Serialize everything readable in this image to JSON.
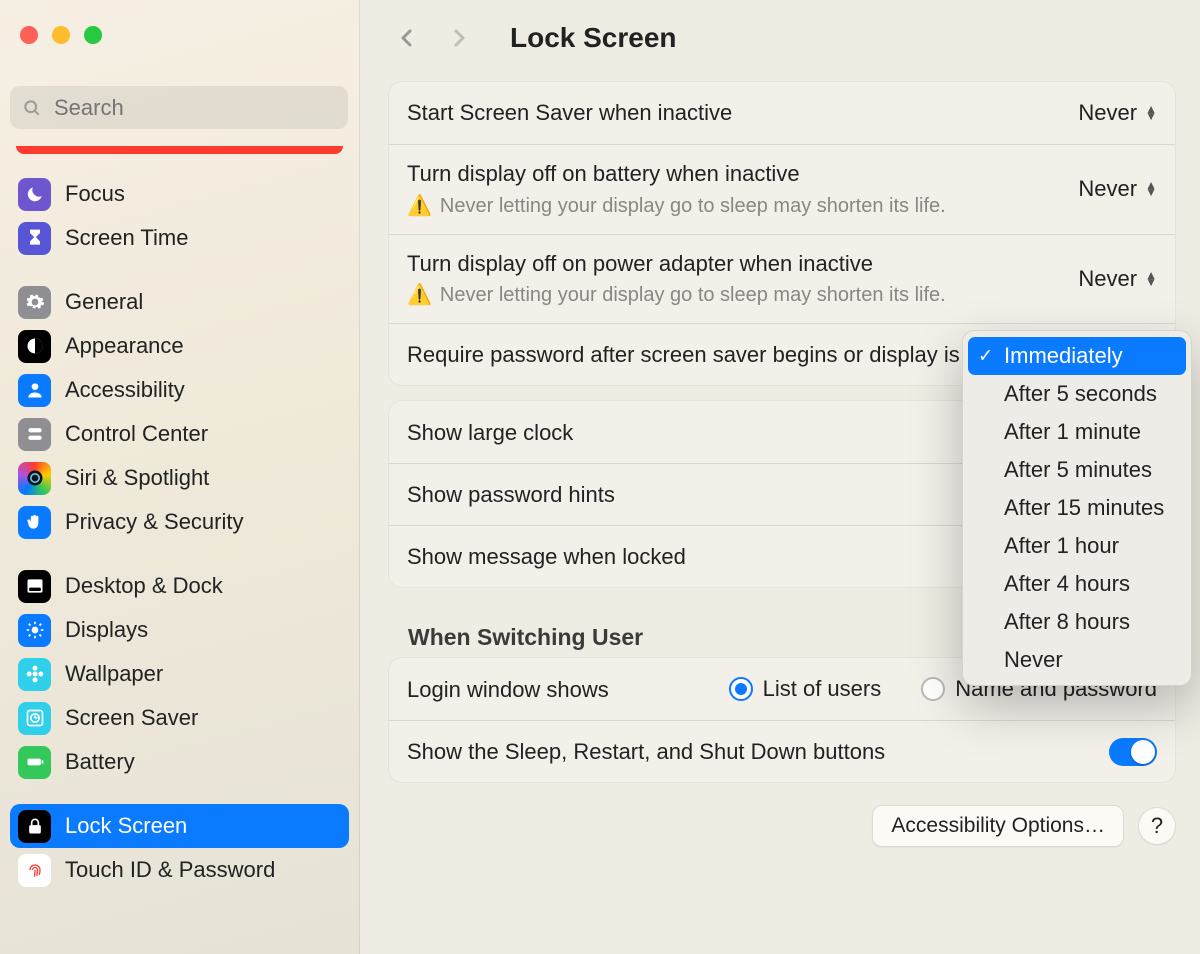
{
  "window": {
    "title": "Lock Screen"
  },
  "search": {
    "placeholder": "Search"
  },
  "sidebar": [
    {
      "id": "focus",
      "label": "Focus",
      "icon": "moon-icon",
      "tint": "ic-purple"
    },
    {
      "id": "screentime",
      "label": "Screen Time",
      "icon": "hourglass-icon",
      "tint": "ic-indigo"
    },
    {
      "gap": true
    },
    {
      "id": "general",
      "label": "General",
      "icon": "gear-icon",
      "tint": "ic-gray"
    },
    {
      "id": "appearance",
      "label": "Appearance",
      "icon": "contrast-icon",
      "tint": "ic-black"
    },
    {
      "id": "accessibility",
      "label": "Accessibility",
      "icon": "person-icon",
      "tint": "ic-blue"
    },
    {
      "id": "controlcenter",
      "label": "Control Center",
      "icon": "switches-icon",
      "tint": "ic-gray"
    },
    {
      "id": "siri",
      "label": "Siri & Spotlight",
      "icon": "siri-icon",
      "tint": "ic-rgb"
    },
    {
      "id": "privacy",
      "label": "Privacy & Security",
      "icon": "hand-icon",
      "tint": "ic-blue"
    },
    {
      "gap": true
    },
    {
      "id": "desktop",
      "label": "Desktop & Dock",
      "icon": "dock-icon",
      "tint": "ic-black"
    },
    {
      "id": "displays",
      "label": "Displays",
      "icon": "sun-icon",
      "tint": "ic-blue"
    },
    {
      "id": "wallpaper",
      "label": "Wallpaper",
      "icon": "flower-icon",
      "tint": "ic-teal"
    },
    {
      "id": "screensaver",
      "label": "Screen Saver",
      "icon": "clock-square-icon",
      "tint": "ic-teal"
    },
    {
      "id": "battery",
      "label": "Battery",
      "icon": "battery-icon",
      "tint": "ic-green"
    },
    {
      "gap": true
    },
    {
      "id": "lockscreen",
      "label": "Lock Screen",
      "icon": "lock-icon",
      "tint": "ic-black",
      "selected": true
    },
    {
      "id": "touchid",
      "label": "Touch ID & Password",
      "icon": "fingerprint-icon",
      "tint": "ic-white"
    }
  ],
  "settings_a": [
    {
      "id": "screensaver_inactive",
      "label": "Start Screen Saver when inactive",
      "value": "Never"
    },
    {
      "id": "display_off_battery",
      "label": "Turn display off on battery when inactive",
      "value": "Never",
      "warn": "Never letting your display go to sleep may shorten its life."
    },
    {
      "id": "display_off_power",
      "label": "Turn display off on power adapter when inactive",
      "value": "Never",
      "warn": "Never letting your display go to sleep may shorten its life."
    },
    {
      "id": "require_password",
      "label": "Require password after screen saver begins or display is turned off"
    }
  ],
  "password_menu": {
    "selected_index": 0,
    "options": [
      "Immediately",
      "After 5 seconds",
      "After 1 minute",
      "After 5 minutes",
      "After 15 minutes",
      "After 1 hour",
      "After 4 hours",
      "After 8 hours",
      "Never"
    ]
  },
  "settings_b": [
    {
      "id": "large_clock",
      "label": "Show large clock"
    },
    {
      "id": "password_hints",
      "label": "Show password hints"
    },
    {
      "id": "message_locked",
      "label": "Show message when locked"
    }
  ],
  "switching_user": {
    "heading": "When Switching User",
    "login_label": "Login window shows",
    "opt_list": "List of users",
    "opt_name": "Name and password",
    "selected": "list",
    "sleep_label": "Show the Sleep, Restart, and Shut Down buttons",
    "sleep_on": true
  },
  "footer": {
    "accessibility_btn": "Accessibility Options…",
    "help": "?"
  }
}
